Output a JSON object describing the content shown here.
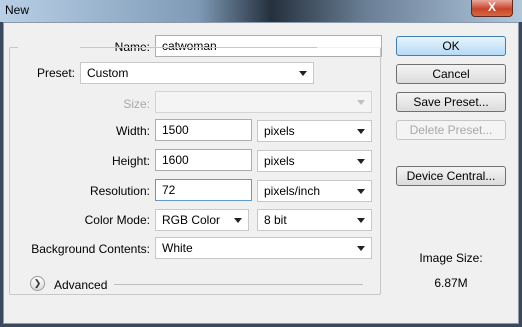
{
  "window": {
    "title": "New",
    "close_label": "X"
  },
  "form": {
    "name_label": "Name:",
    "name_value": "catwoman",
    "preset_label": "Preset:",
    "preset_value": "Custom",
    "size_label": "Size:",
    "size_value": "",
    "width_label": "Width:",
    "width_value": "1500",
    "width_unit": "pixels",
    "height_label": "Height:",
    "height_value": "1600",
    "height_unit": "pixels",
    "resolution_label": "Resolution:",
    "resolution_value": "72",
    "resolution_unit": "pixels/inch",
    "color_mode_label": "Color Mode:",
    "color_mode_value": "RGB Color",
    "bit_depth_value": "8 bit",
    "background_label": "Background Contents:",
    "background_value": "White",
    "advanced_label": "Advanced"
  },
  "buttons": {
    "ok": "OK",
    "cancel": "Cancel",
    "save_preset": "Save Preset...",
    "delete_preset": "Delete Preset...",
    "device_central": "Device Central..."
  },
  "image_size": {
    "label": "Image Size:",
    "value": "6.87M"
  },
  "icons": {
    "dropdown": "chevron-down-icon",
    "advanced": "double-chevron-down-icon",
    "close": "close-icon"
  }
}
